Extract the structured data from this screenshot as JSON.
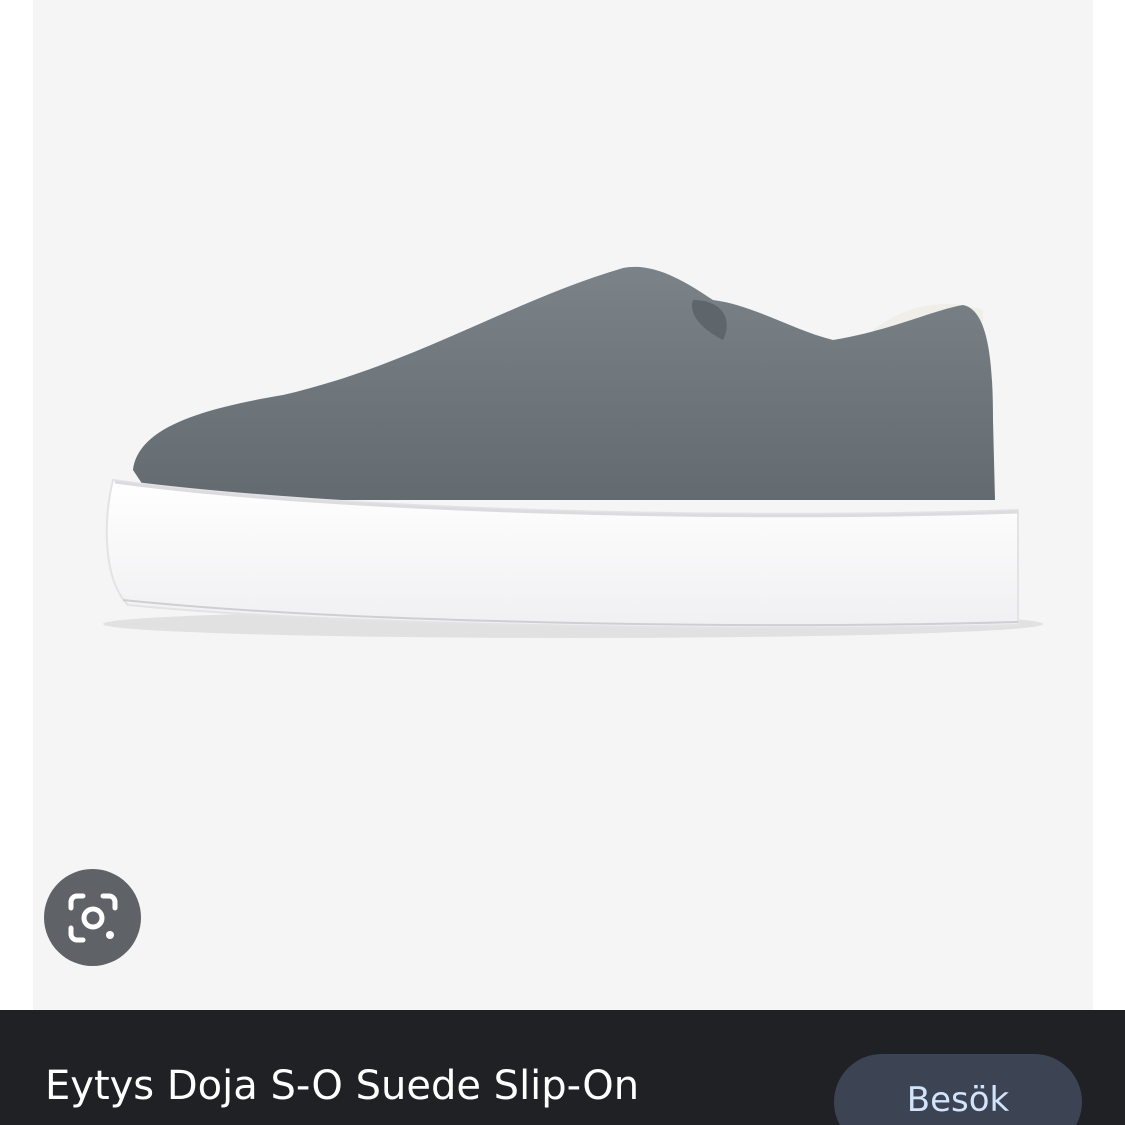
{
  "product": {
    "title": "Eytys Doja S-O Suede Slip-On",
    "image_alt": "Grey suede slip-on sneaker with white platform sole"
  },
  "actions": {
    "visit_label": "Besök",
    "lens_icon": "google-lens-icon"
  },
  "colors": {
    "image_background": "#f5f5f5",
    "bottom_bar": "#202124",
    "lens_button": "#5f6368",
    "visit_button_bg": "#3c4454",
    "visit_button_text": "#d2e3fc",
    "suede": "#6f777d",
    "sole": "#ffffff"
  }
}
